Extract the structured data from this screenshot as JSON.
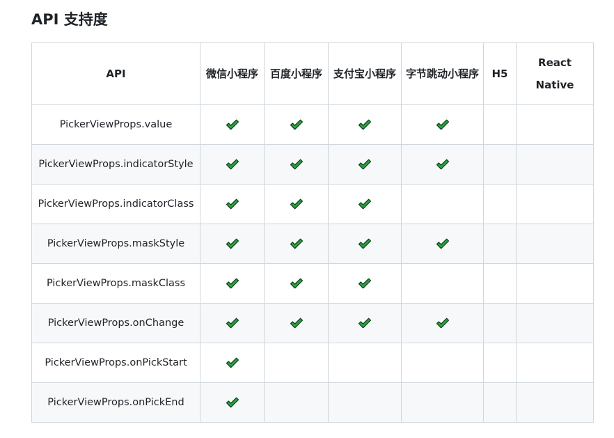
{
  "heading": "API 支持度",
  "table": {
    "columns": [
      {
        "key": "api",
        "label": "API"
      },
      {
        "key": "weapp",
        "label": "微信小程序"
      },
      {
        "key": "swan",
        "label": "百度小程序"
      },
      {
        "key": "alipay",
        "label": "支付宝小程序"
      },
      {
        "key": "tt",
        "label": "字节跳动小程序"
      },
      {
        "key": "h5",
        "label": "H5"
      },
      {
        "key": "rn",
        "label": "React Native"
      }
    ],
    "rows": [
      {
        "api": "PickerViewProps.value",
        "weapp": true,
        "swan": true,
        "alipay": true,
        "tt": true,
        "h5": false,
        "rn": false
      },
      {
        "api": "PickerViewProps.indicatorStyle",
        "weapp": true,
        "swan": true,
        "alipay": true,
        "tt": true,
        "h5": false,
        "rn": false
      },
      {
        "api": "PickerViewProps.indicatorClass",
        "weapp": true,
        "swan": true,
        "alipay": true,
        "tt": false,
        "h5": false,
        "rn": false
      },
      {
        "api": "PickerViewProps.maskStyle",
        "weapp": true,
        "swan": true,
        "alipay": true,
        "tt": true,
        "h5": false,
        "rn": false
      },
      {
        "api": "PickerViewProps.maskClass",
        "weapp": true,
        "swan": true,
        "alipay": true,
        "tt": false,
        "h5": false,
        "rn": false
      },
      {
        "api": "PickerViewProps.onChange",
        "weapp": true,
        "swan": true,
        "alipay": true,
        "tt": true,
        "h5": false,
        "rn": false
      },
      {
        "api": "PickerViewProps.onPickStart",
        "weapp": true,
        "swan": false,
        "alipay": false,
        "tt": false,
        "h5": false,
        "rn": false
      },
      {
        "api": "PickerViewProps.onPickEnd",
        "weapp": true,
        "swan": false,
        "alipay": false,
        "tt": false,
        "h5": false,
        "rn": false
      }
    ]
  },
  "icons": {
    "supported": "check-mark-icon"
  },
  "colors": {
    "check_fill": "#2ea043",
    "check_stroke": "#0b3d16",
    "border": "#d0d7de",
    "stripe": "#f6f8fa"
  }
}
